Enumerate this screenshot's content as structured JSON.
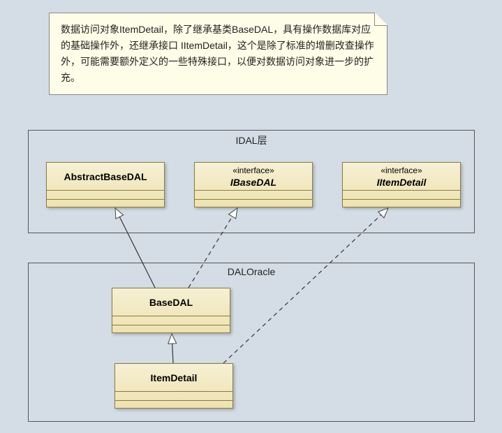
{
  "note": {
    "text": "数据访问对象ItemDetail，除了继承基类BaseDAL，具有操作数据库对应的基础操作外，还继承接口\nIItemDetail，这个是除了标准的增删改查操作外，可能需要额外定义的一些特殊接口，以便对数据访问对象进一步的扩充。"
  },
  "packages": {
    "idal": {
      "label": "IDAL层"
    },
    "dal_oracle": {
      "label": "DALOracle"
    }
  },
  "classes": {
    "abstract_base_dal": {
      "name": "AbstractBaseDAL",
      "stereotype": ""
    },
    "ibase_dal": {
      "name": "IBaseDAL",
      "stereotype": "«interface»"
    },
    "iitem_detail": {
      "name": "IItemDetail",
      "stereotype": "«interface»"
    },
    "base_dal": {
      "name": "BaseDAL",
      "stereotype": ""
    },
    "item_detail": {
      "name": "ItemDetail",
      "stereotype": ""
    }
  },
  "relationships": [
    {
      "from": "BaseDAL",
      "to": "AbstractBaseDAL",
      "type": "generalization"
    },
    {
      "from": "BaseDAL",
      "to": "IBaseDAL",
      "type": "realization"
    },
    {
      "from": "ItemDetail",
      "to": "BaseDAL",
      "type": "generalization"
    },
    {
      "from": "ItemDetail",
      "to": "IItemDetail",
      "type": "realization"
    }
  ]
}
